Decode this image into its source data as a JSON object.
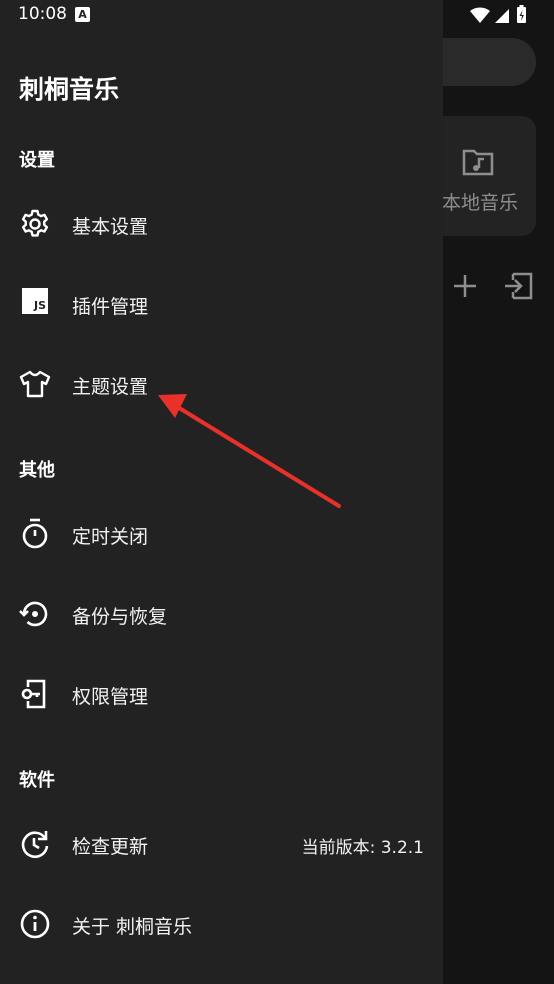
{
  "status_bar": {
    "time": "10:08",
    "notification_icon": "A"
  },
  "background": {
    "card_label": "本地音乐",
    "card_icon": "music-folder-icon"
  },
  "drawer": {
    "title": "刺桐音乐",
    "sections": {
      "settings": "设置",
      "other": "其他",
      "software": "软件"
    },
    "items": {
      "basic_settings": "基本设置",
      "plugin_management": "插件管理",
      "plugin_icon_text": "JS",
      "theme_settings": "主题设置",
      "sleep_timer": "定时关闭",
      "backup_restore": "备份与恢复",
      "permission_management": "权限管理",
      "check_update": "检查更新",
      "current_version": "当前版本: 3.2.1",
      "about": "关于 刺桐音乐"
    }
  },
  "colors": {
    "drawer_bg": "#222222",
    "annotation_arrow": "#e8312a"
  }
}
